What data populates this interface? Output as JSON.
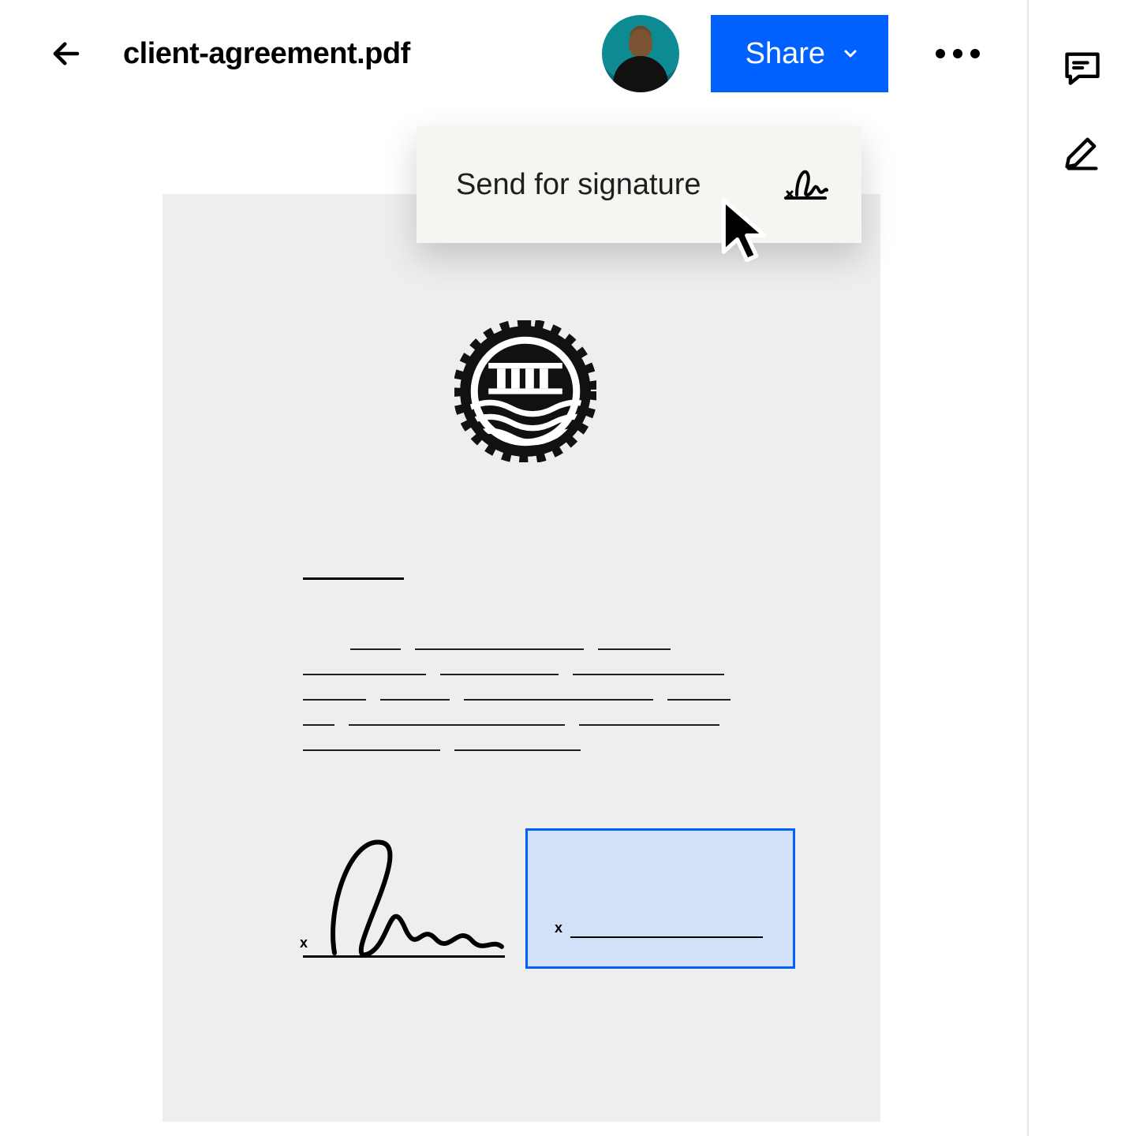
{
  "header": {
    "filename": "client-agreement.pdf",
    "share_label": "Share"
  },
  "dropdown": {
    "send_for_signature_label": "Send for signature"
  },
  "signature": {
    "x_marker_left": "x",
    "x_marker_right": "x"
  },
  "colors": {
    "accent": "#0061fe",
    "dropdown_bg": "#f7f5f2",
    "doc_bg": "#eeeeee",
    "sig_field_fill": "#d3e1f8"
  },
  "icons": {
    "back": "back-arrow-icon",
    "chevron_down": "chevron-down-icon",
    "more": "more-icon",
    "comment": "comment-icon",
    "edit": "edit-icon",
    "signature": "signature-icon",
    "cursor": "cursor-icon"
  }
}
